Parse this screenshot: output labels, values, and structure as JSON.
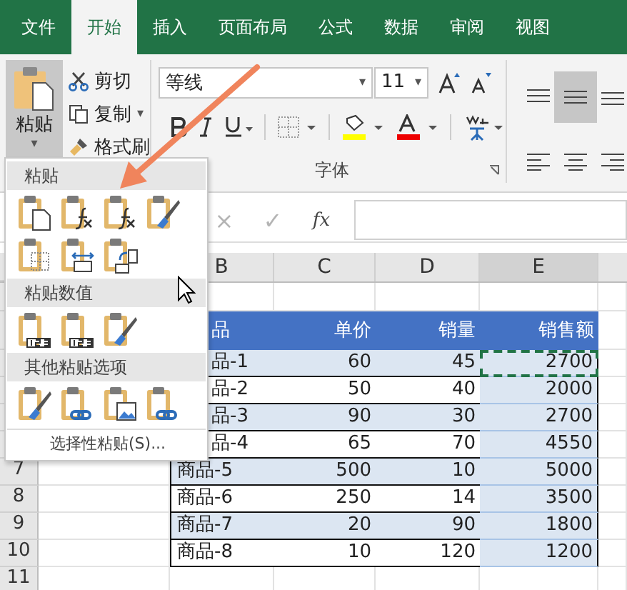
{
  "tabs": [
    {
      "label": "文件",
      "selected": false
    },
    {
      "label": "开始",
      "selected": true
    },
    {
      "label": "插入",
      "selected": false
    },
    {
      "label": "页面布局",
      "selected": false
    },
    {
      "label": "公式",
      "selected": false
    },
    {
      "label": "数据",
      "selected": false
    },
    {
      "label": "审阅",
      "selected": false
    },
    {
      "label": "视图",
      "selected": false
    }
  ],
  "clipboard": {
    "paste_label": "粘贴",
    "paste_caret": "▾",
    "paste_pressed": true,
    "commands": [
      {
        "label": "剪切",
        "kind": "cut"
      },
      {
        "label": "复制",
        "kind": "copy",
        "caret": "▾"
      },
      {
        "label": "格式刷",
        "kind": "brush"
      }
    ]
  },
  "font": {
    "name": "等线",
    "name_caret": "▾",
    "size": "11",
    "size_caret": "▾",
    "group_label": "字体"
  },
  "formula_bar": {
    "cancel": "×",
    "enter": "✓",
    "function": "fx"
  },
  "columns": [
    {
      "label": "B",
      "selected": false
    },
    {
      "label": "C",
      "selected": false
    },
    {
      "label": "D",
      "selected": false
    },
    {
      "label": "E",
      "selected": true
    }
  ],
  "rows": [
    {
      "kind": "blank"
    },
    {
      "kind": "header",
      "partial": true,
      "cells": [
        "品",
        "单价",
        "销量",
        "销售额"
      ]
    },
    {
      "kind": "data",
      "partial": true,
      "copied": true,
      "cells": [
        "品-1",
        "60",
        "45",
        "2700"
      ]
    },
    {
      "kind": "data",
      "partial": true,
      "copied": false,
      "cells": [
        "品-2",
        "50",
        "40",
        "2000"
      ]
    },
    {
      "kind": "data",
      "partial": true,
      "copied": false,
      "cells": [
        "品-3",
        "90",
        "30",
        "2700"
      ]
    },
    {
      "kind": "data",
      "partial": true,
      "copied": false,
      "cells": [
        "品-4",
        "65",
        "70",
        "4550"
      ]
    },
    {
      "kind": "data",
      "number": "7",
      "partial": false,
      "copied": false,
      "cells": [
        "商品-5",
        "500",
        "10",
        "5000"
      ]
    },
    {
      "kind": "data",
      "number": "8",
      "partial": false,
      "copied": false,
      "cells": [
        "商品-6",
        "250",
        "14",
        "3500"
      ]
    },
    {
      "kind": "data",
      "number": "9",
      "partial": false,
      "copied": false,
      "cells": [
        "商品-7",
        "20",
        "90",
        "1800"
      ]
    },
    {
      "kind": "data",
      "number": "10",
      "partial": false,
      "copied": false,
      "cells": [
        "商品-8",
        "10",
        "120",
        "1200"
      ]
    },
    {
      "kind": "blank",
      "number": "11"
    }
  ],
  "paste_menu": {
    "sections": [
      {
        "title": "粘贴",
        "options": [
          {
            "kind": "paste"
          },
          {
            "kind": "formulas"
          },
          {
            "kind": "formulas-number"
          },
          {
            "kind": "keep-source"
          },
          {
            "kind": "no-borders"
          },
          {
            "kind": "column-widths"
          },
          {
            "kind": "transpose"
          }
        ]
      },
      {
        "title": "粘贴数值",
        "options": [
          {
            "kind": "values"
          },
          {
            "kind": "values-number"
          },
          {
            "kind": "values-source"
          }
        ]
      },
      {
        "title": "其他粘贴选项",
        "options": [
          {
            "kind": "formatting"
          },
          {
            "kind": "link"
          },
          {
            "kind": "picture"
          },
          {
            "kind": "linked-picture"
          }
        ]
      }
    ],
    "special": "选择性粘贴(S)..."
  }
}
